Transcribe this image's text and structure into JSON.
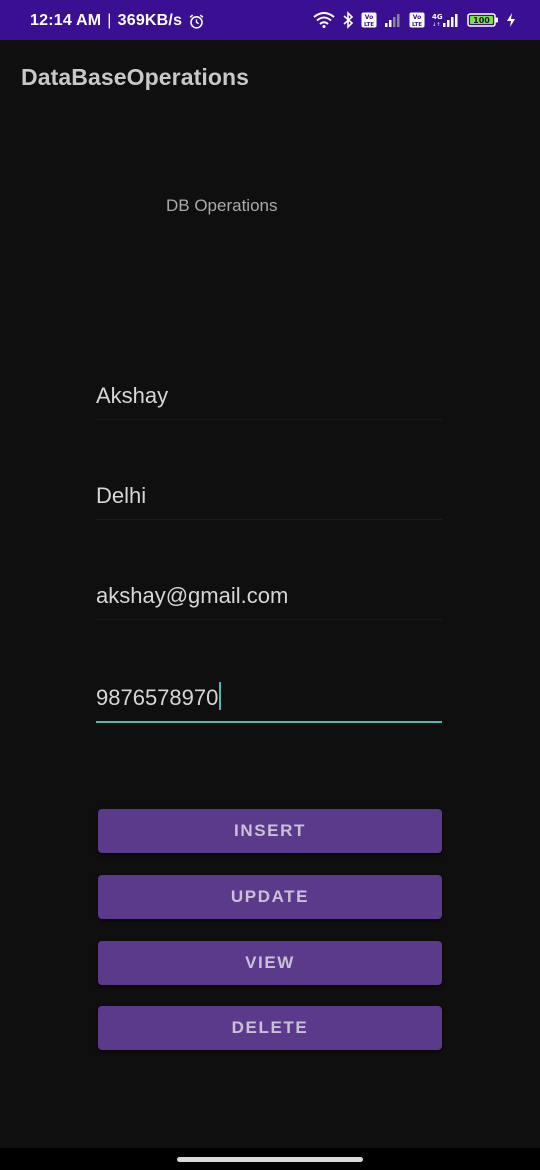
{
  "status_bar": {
    "time": "12:14 AM",
    "separator": "|",
    "speed": "369KB/s",
    "battery": "100",
    "network_label": "4G",
    "volte_label": "Vo LTE"
  },
  "app_bar": {
    "title": "DataBaseOperations"
  },
  "main": {
    "heading": "DB Operations",
    "fields": {
      "name": "Akshay",
      "city": "Delhi",
      "email": "akshay@gmail.com",
      "phone": "9876578970"
    },
    "buttons": {
      "insert": "INSERT",
      "update": "UPDATE",
      "view": "VIEW",
      "delete": "DELETE"
    }
  },
  "colors": {
    "status_bar": "#3a0f92",
    "background": "#0f0f0f",
    "button": "#5b3a8c",
    "accent": "#4dbdb0"
  },
  "icons": [
    "alarm-icon",
    "wifi-icon",
    "bluetooth-icon",
    "volte-icon",
    "signal-icon",
    "battery-icon",
    "charging-icon"
  ]
}
